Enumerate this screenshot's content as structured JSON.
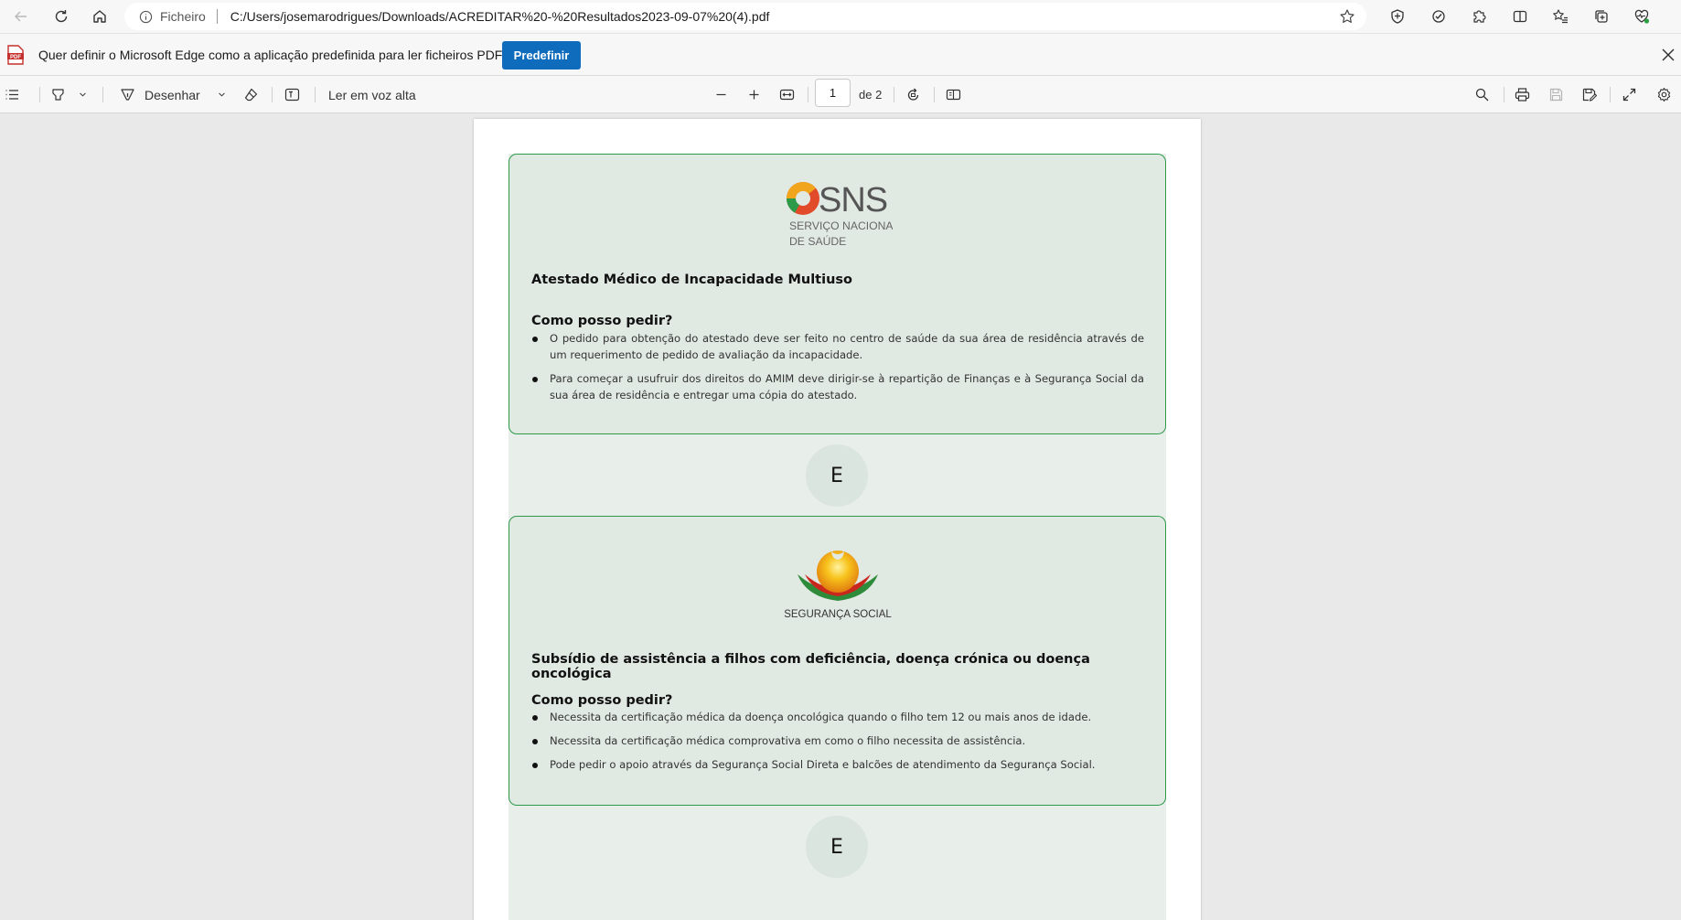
{
  "browser": {
    "address_prefix": "Ficheiro",
    "url": "C:/Users/josemarodrigues/Downloads/ACREDITAR%20-%20Resultados2023-09-07%20(4).pdf"
  },
  "infobar": {
    "message": "Quer definir o Microsoft Edge como a aplicação predefinida para ler ficheiros PDF?",
    "button_label": "Predefinir",
    "badge_text": "PDF"
  },
  "pdf_toolbar": {
    "draw_label": "Desenhar",
    "read_aloud_label": "Ler em voz alta",
    "page_current": "1",
    "page_total_label": "de 2"
  },
  "document": {
    "card1": {
      "logo_main": "SNS",
      "logo_line1": "SERVIÇO NACIONAL",
      "logo_line2": "DE SAÚDE",
      "title": "Atestado Médico de Incapacidade Multiuso",
      "subtitle": "Como posso pedir?",
      "bullets": [
        "O pedido para obtenção do atestado deve ser feito no centro de saúde da sua área de residência através de um requerimento de pedido de avaliação da incapacidade.",
        "Para começar a usufruir dos direitos do AMIM deve dirigir-se à repartição de Finanças e à Segurança Social da sua área de residência e entregar uma cópia do atestado."
      ]
    },
    "connector1": "E",
    "card2": {
      "logo_text": "SEGURANÇA SOCIAL",
      "title": "Subsídio de assistência a filhos com deficiência, doença crónica ou doença oncológica",
      "subtitle": "Como posso pedir?",
      "bullets": [
        "Necessita da certificação médica da doença oncológica quando o filho tem 12 ou mais anos de idade.",
        "Necessita da certificação médica comprovativa em como o filho necessita de assistência.",
        "Pode pedir o apoio através da Segurança Social Direta e balcões de atendimento da Segurança Social."
      ]
    },
    "connector2": "E"
  },
  "colors": {
    "card_border": "#2d9a4a",
    "card_bg": "#e1e9e3",
    "primary_button": "#0f6cbd"
  }
}
